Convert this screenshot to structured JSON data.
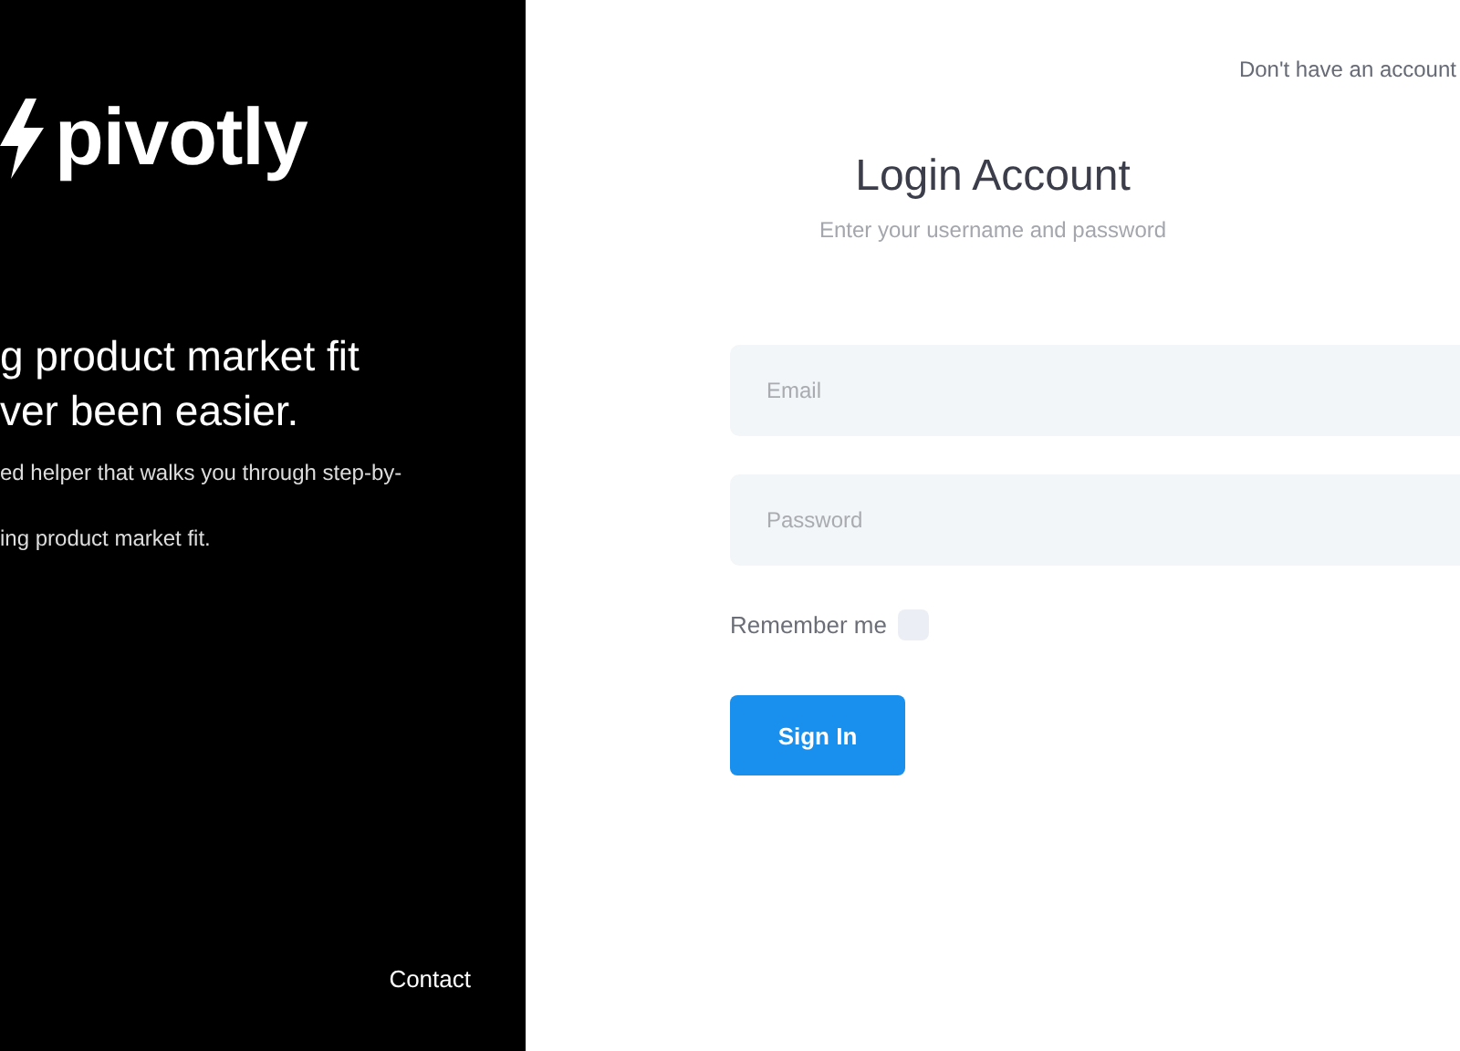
{
  "brand": {
    "name": "pivotly"
  },
  "hero": {
    "headline_lines": [
      "g product market fit",
      "ver been easier."
    ],
    "body_lines": [
      "ed helper that walks you through step-by-",
      "ing product market fit."
    ]
  },
  "footer_links": [
    "Contact"
  ],
  "signup_prompt": "Don't have an account",
  "form": {
    "title": "Login Account",
    "subtitle": "Enter your username and password",
    "fields": [
      {
        "placeholder": "Email"
      },
      {
        "placeholder": "Password"
      }
    ],
    "remember": {
      "label": "Remember me",
      "checked": false
    },
    "submit": "Sign In"
  }
}
